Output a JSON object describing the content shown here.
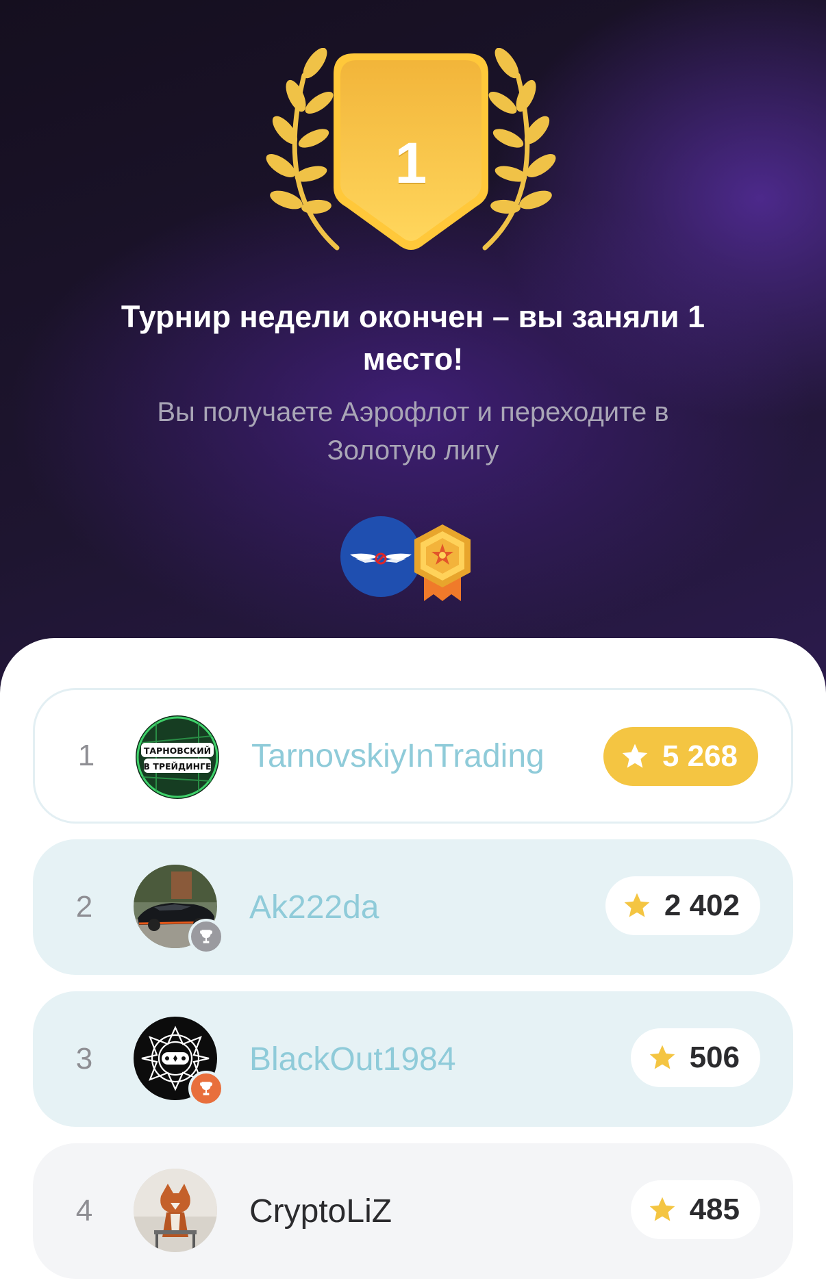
{
  "badge": {
    "rank_number": "1"
  },
  "headline": "Турнир недели окончен – вы заняли 1 место!",
  "subline": "Вы получаете Аэрофлот и переходите в Золотую лигу",
  "rewards": {
    "items": [
      "aeroflot-logo-icon",
      "gold-league-badge-icon"
    ]
  },
  "leaderboard": {
    "rows": [
      {
        "position": "1",
        "username": "TarnovskiyInTrading",
        "score": "5 268",
        "avatar_text_1": "ТАРНОВСКИЙ",
        "avatar_text_2": "В ТРЕЙДИНГЕ"
      },
      {
        "position": "2",
        "username": "Ak222da",
        "score": "2 402"
      },
      {
        "position": "3",
        "username": "BlackOut1984",
        "score": "506"
      },
      {
        "position": "4",
        "username": "CryptoLiZ",
        "score": "485"
      }
    ]
  },
  "colors": {
    "gold": "#f4c542",
    "username_link": "#8fcbd9",
    "row_highlight": "#e6f2f5",
    "silver_trophy": "#9a9a9f",
    "bronze_trophy": "#e86f3c"
  }
}
